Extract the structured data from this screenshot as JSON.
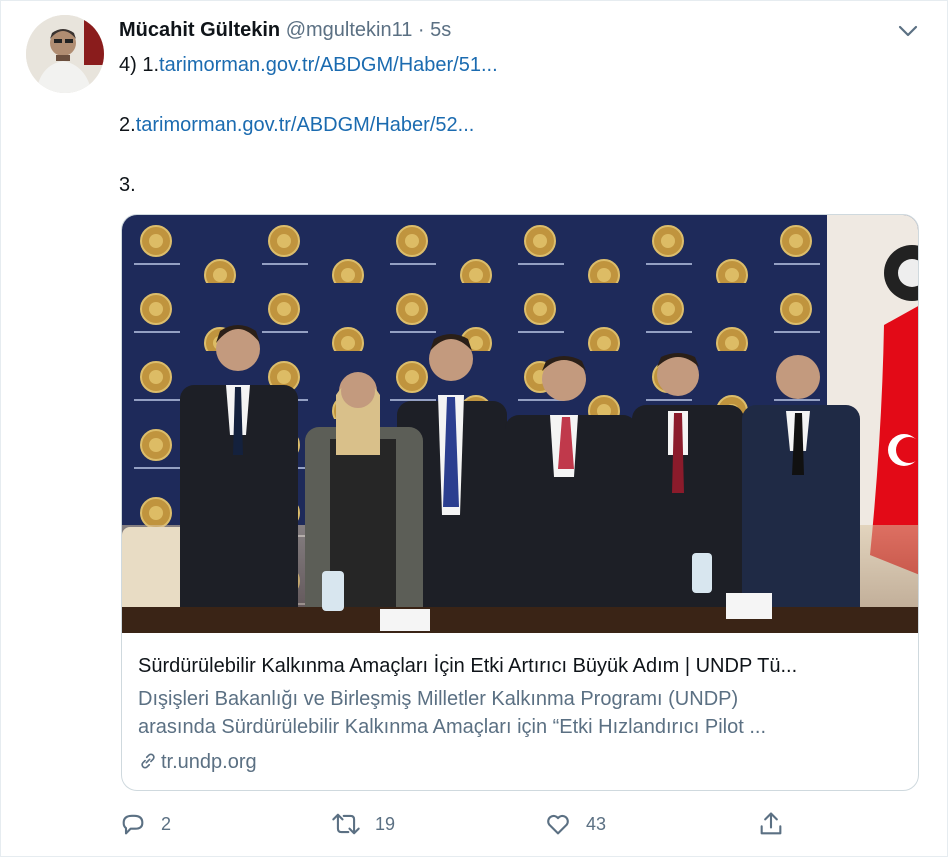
{
  "tweet": {
    "author": {
      "name": "Mücahit Gültekin",
      "handle": "@mgultekin11",
      "separator": "·",
      "timestamp": "5s"
    },
    "body": {
      "line1_prefix": "4) 1.",
      "link1": "tarimorman.gov.tr/ABDGM/Haber/51...",
      "line2_prefix": "2.",
      "link2": "tarimorman.gov.tr/ABDGM/Haber/52...",
      "line3": "3."
    },
    "card": {
      "title": "Sürdürülebilir Kalkınma Amaçları İçin Etki Artırıcı Büyük Adım | UNDP Tü...",
      "description_line1": "Dışişleri Bakanlığı ve Birleşmiş Milletler Kalkınma Programı (UNDP)",
      "description_line2": "arasında Sürdürülebilir Kalkınma Amaçları için “Etki Hızlandırıcı Pilot ...",
      "domain": "tr.undp.org"
    },
    "actions": {
      "reply_count": "2",
      "retweet_count": "19",
      "like_count": "43"
    }
  },
  "colors": {
    "link": "#1b6bb0",
    "secondary_text": "#5b7083",
    "backdrop_navy": "#1e2a5a",
    "flag_red": "#e30a17"
  },
  "icons": [
    "caret-down-icon",
    "link-chain-icon",
    "reply-icon",
    "retweet-icon",
    "like-icon",
    "share-icon"
  ]
}
